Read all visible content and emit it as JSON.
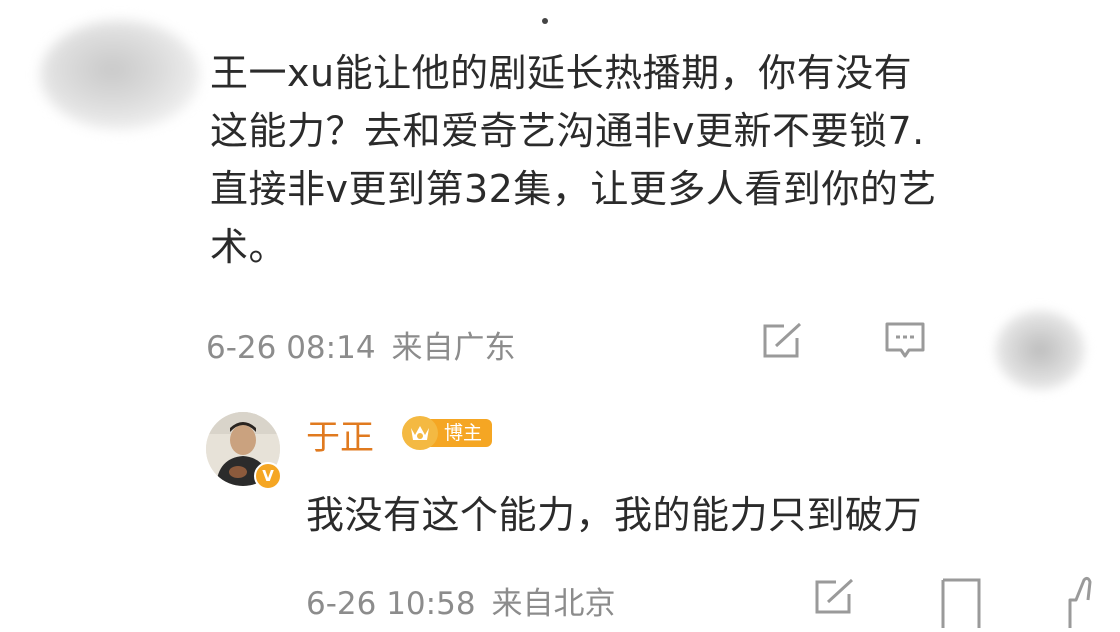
{
  "comment": {
    "lines": [
      "王一xu能让他的剧延长热播期，你有没有",
      "这能力？去和爱奇艺沟通非v更新不要锁7.",
      "直接非v更到第32集，让更多人看到你的艺",
      "术。"
    ],
    "date": "6-26 08:14",
    "location": "来自广东"
  },
  "reply": {
    "name": "于正",
    "badge": "博主",
    "verified_mark": "V",
    "text": "我没有这个能力，我的能力只到破万",
    "date": "6-26 10:58",
    "location": "来自北京"
  },
  "colors": {
    "name": "#e07a1f",
    "badge": "#f5a623",
    "meta": "#8c8c8c",
    "text": "#2b2b2b"
  }
}
